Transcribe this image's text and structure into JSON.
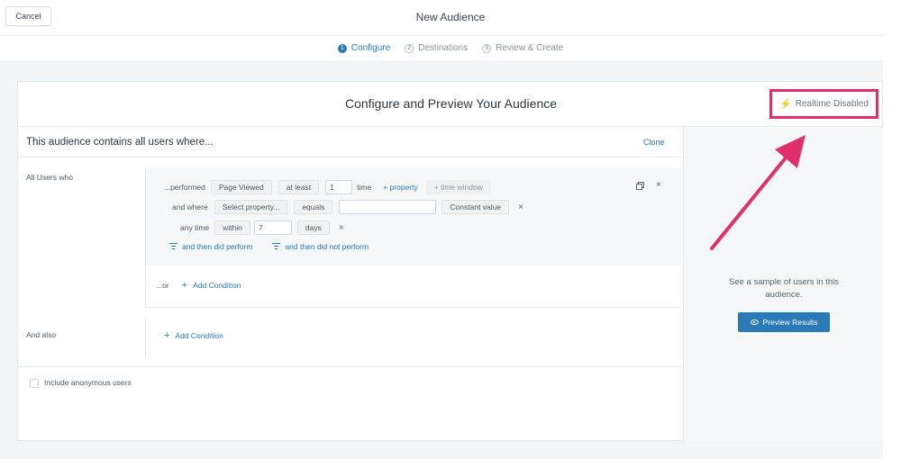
{
  "header": {
    "cancel_label": "Cancel",
    "title": "New Audience",
    "steps": [
      {
        "num": "1",
        "label": "Configure"
      },
      {
        "num": "2",
        "label": "Destinations"
      },
      {
        "num": "3",
        "label": "Review & Create"
      }
    ]
  },
  "card": {
    "title": "Configure and Preview Your Audience",
    "realtime_label": "Realtime Disabled",
    "contains_text": "This audience contains all users where...",
    "clone_label": "Clone"
  },
  "conditions": {
    "all_users_label": "All Users who",
    "row1": {
      "performed": "...performed",
      "event": "Page Viewed",
      "operator": "at least",
      "count": "1",
      "unit": "time",
      "add_property": "+ property",
      "add_time_window": "+ time window"
    },
    "row2": {
      "and_where": "and where",
      "property_placeholder": "Select property...",
      "comparator": "equals",
      "value": "",
      "value_type": "Constant value"
    },
    "row3": {
      "any_time": "any time",
      "within": "within",
      "amount": "7",
      "unit": "days"
    },
    "then_did_perform": "and then did perform",
    "then_did_not_perform": "and then did not perform",
    "or_label": "...or",
    "add_condition": "Add Condition",
    "and_also_label": "And also",
    "add_condition_2": "Add Condition",
    "include_anonymous": "Include anonymous users"
  },
  "preview": {
    "sample_text": "See a sample of users in this audience.",
    "button_label": "Preview Results"
  },
  "colors": {
    "accent": "#2a7ab8",
    "highlight": "#e0306b"
  }
}
